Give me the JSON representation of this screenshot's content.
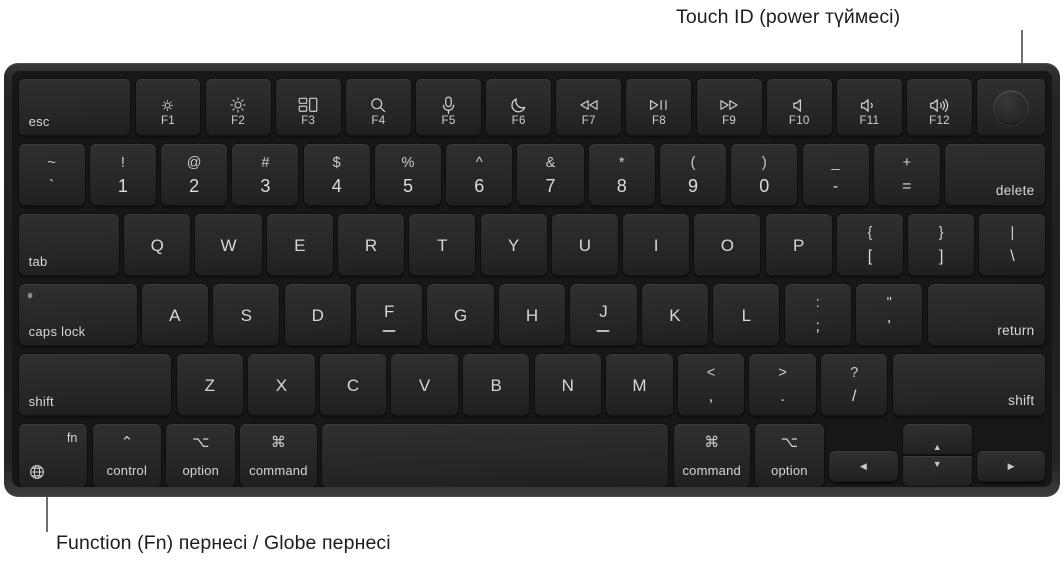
{
  "annotations": {
    "touch_id": {
      "text": "Touch ID (power түймесі)"
    },
    "fn_globe": {
      "text": "Function (Fn) пернесі / Globe пернесі"
    }
  },
  "colors": {
    "page_background": "#ffffff",
    "chassis": "#242426",
    "keybed": "#17171a",
    "keycap": "#2a2a2d",
    "legend": "#d7d7da",
    "callout_text": "#1d1d1f",
    "callout_line": "#6e6e73"
  },
  "keyboard": {
    "rows": {
      "function_row": [
        {
          "label": "esc",
          "icon": null,
          "fkey": null,
          "width": 1.72
        },
        {
          "label": null,
          "icon": "brightness-down-icon",
          "fkey": "F1",
          "width": 1
        },
        {
          "label": null,
          "icon": "brightness-up-icon",
          "fkey": "F2",
          "width": 1
        },
        {
          "label": null,
          "icon": "mission-control-icon",
          "fkey": "F3",
          "width": 1
        },
        {
          "label": null,
          "icon": "spotlight-search-icon",
          "fkey": "F4",
          "width": 1
        },
        {
          "label": null,
          "icon": "dictation-microphone-icon",
          "fkey": "F5",
          "width": 1
        },
        {
          "label": null,
          "icon": "do-not-disturb-moon-icon",
          "fkey": "F6",
          "width": 1
        },
        {
          "label": null,
          "icon": "rewind-icon",
          "fkey": "F7",
          "width": 1
        },
        {
          "label": null,
          "icon": "play-pause-icon",
          "fkey": "F8",
          "width": 1
        },
        {
          "label": null,
          "icon": "fast-forward-icon",
          "fkey": "F9",
          "width": 1
        },
        {
          "label": null,
          "icon": "mute-icon",
          "fkey": "F10",
          "width": 1
        },
        {
          "label": null,
          "icon": "volume-down-icon",
          "fkey": "F11",
          "width": 1
        },
        {
          "label": null,
          "icon": "volume-up-icon",
          "fkey": "F12",
          "width": 1
        },
        {
          "label": null,
          "icon": "touch-id-icon",
          "fkey": null,
          "width": 1
        }
      ],
      "number_row": [
        {
          "upper": "~",
          "lower": "`",
          "width": 1
        },
        {
          "upper": "!",
          "lower": "1",
          "width": 1
        },
        {
          "upper": "@",
          "lower": "2",
          "width": 1
        },
        {
          "upper": "#",
          "lower": "3",
          "width": 1
        },
        {
          "upper": "$",
          "lower": "4",
          "width": 1
        },
        {
          "upper": "%",
          "lower": "5",
          "width": 1
        },
        {
          "upper": "^",
          "lower": "6",
          "width": 1
        },
        {
          "upper": "&",
          "lower": "7",
          "width": 1
        },
        {
          "upper": "*",
          "lower": "8",
          "width": 1
        },
        {
          "upper": "(",
          "lower": "9",
          "width": 1
        },
        {
          "upper": ")",
          "lower": "0",
          "width": 1
        },
        {
          "upper": "_",
          "lower": "-",
          "width": 1
        },
        {
          "upper": "+",
          "lower": "=",
          "width": 1
        },
        {
          "upper": null,
          "lower": null,
          "corner": "delete",
          "width": 1.52
        }
      ],
      "qwerty_row": [
        {
          "corner_bl": "tab",
          "width": 1.52
        },
        {
          "center": "Q",
          "width": 1
        },
        {
          "center": "W",
          "width": 1
        },
        {
          "center": "E",
          "width": 1
        },
        {
          "center": "R",
          "width": 1
        },
        {
          "center": "T",
          "width": 1
        },
        {
          "center": "Y",
          "width": 1
        },
        {
          "center": "U",
          "width": 1
        },
        {
          "center": "I",
          "width": 1
        },
        {
          "center": "O",
          "width": 1
        },
        {
          "center": "P",
          "width": 1
        },
        {
          "upper": "{",
          "lower": "[",
          "width": 1
        },
        {
          "upper": "}",
          "lower": "]",
          "width": 1
        },
        {
          "upper": "|",
          "lower": "\\",
          "width": 1
        }
      ],
      "home_row": [
        {
          "corner_bl": "caps lock",
          "led": true,
          "width": 1.78
        },
        {
          "center": "A",
          "width": 1
        },
        {
          "center": "S",
          "width": 1
        },
        {
          "center": "D",
          "width": 1
        },
        {
          "center": "F",
          "bump": true,
          "width": 1
        },
        {
          "center": "G",
          "width": 1
        },
        {
          "center": "H",
          "width": 1
        },
        {
          "center": "J",
          "bump": true,
          "width": 1
        },
        {
          "center": "K",
          "width": 1
        },
        {
          "center": "L",
          "width": 1
        },
        {
          "upper": ":",
          "lower": ";",
          "width": 1
        },
        {
          "upper": "\"",
          "lower": "'",
          "width": 1
        },
        {
          "corner_br": "return",
          "width": 1.78
        }
      ],
      "shift_row": [
        {
          "corner_bl": "shift",
          "width": 2.3
        },
        {
          "center": "Z",
          "width": 1
        },
        {
          "center": "X",
          "width": 1
        },
        {
          "center": "C",
          "width": 1
        },
        {
          "center": "V",
          "width": 1
        },
        {
          "center": "B",
          "width": 1
        },
        {
          "center": "N",
          "width": 1
        },
        {
          "center": "M",
          "width": 1
        },
        {
          "upper": "<",
          "lower": ",",
          "width": 1
        },
        {
          "upper": ">",
          "lower": ".",
          "width": 1
        },
        {
          "upper": "?",
          "lower": "/",
          "width": 1
        },
        {
          "corner_br": "shift",
          "width": 2.3
        }
      ],
      "bottom_row": [
        {
          "type": "fn",
          "corner_tr": "fn",
          "icon": "globe-icon",
          "width": 1.1
        },
        {
          "type": "mod",
          "sym": "⌃",
          "word": "control",
          "width": 1.1
        },
        {
          "type": "mod",
          "sym": "⌥",
          "word": "option",
          "width": 1.1
        },
        {
          "type": "mod",
          "sym": "⌘",
          "word": "command",
          "width": 1.22
        },
        {
          "type": "space",
          "width": 5.55
        },
        {
          "type": "mod",
          "sym": "⌘",
          "word": "command",
          "width": 1.22
        },
        {
          "type": "mod",
          "sym": "⌥",
          "word": "option",
          "width": 1.1
        },
        {
          "type": "arrow-left",
          "icon": "arrow-left-icon",
          "width": 1.1
        },
        {
          "type": "arrow-updown",
          "icon_up": "arrow-up-icon",
          "icon_down": "arrow-down-icon",
          "width": 1.1
        },
        {
          "type": "arrow-right",
          "icon": "arrow-right-icon",
          "width": 1.1
        }
      ]
    },
    "arrow_glyphs": {
      "up": "▲",
      "down": "▼",
      "left": "◀",
      "right": "▶"
    }
  }
}
